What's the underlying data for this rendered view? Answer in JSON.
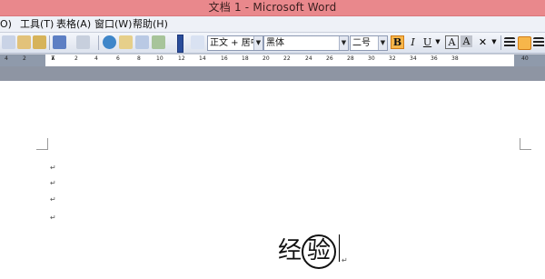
{
  "window": {
    "title": "文档 1 - Microsoft Word"
  },
  "menu": {
    "items": [
      "O)",
      "工具(T)",
      "表格(A)",
      "窗口(W)",
      "帮助(H)"
    ]
  },
  "toolbar": {
    "style": "正文 + 居中",
    "font": "黑体",
    "size": "二号",
    "bold": "B",
    "italic": "I",
    "underline": "U",
    "font_color": "A",
    "char_shading": "A",
    "accent_color": "#f7b64a"
  },
  "ruler": {
    "labels": [
      "4",
      "2",
      "2",
      "4",
      "6",
      "8",
      "10",
      "12",
      "14",
      "16",
      "18",
      "20",
      "22",
      "24",
      "26",
      "28",
      "30",
      "32",
      "34",
      "36",
      "38",
      "40"
    ]
  },
  "document": {
    "paragraph_mark": "↵",
    "text": "经",
    "circled_char": "验"
  }
}
